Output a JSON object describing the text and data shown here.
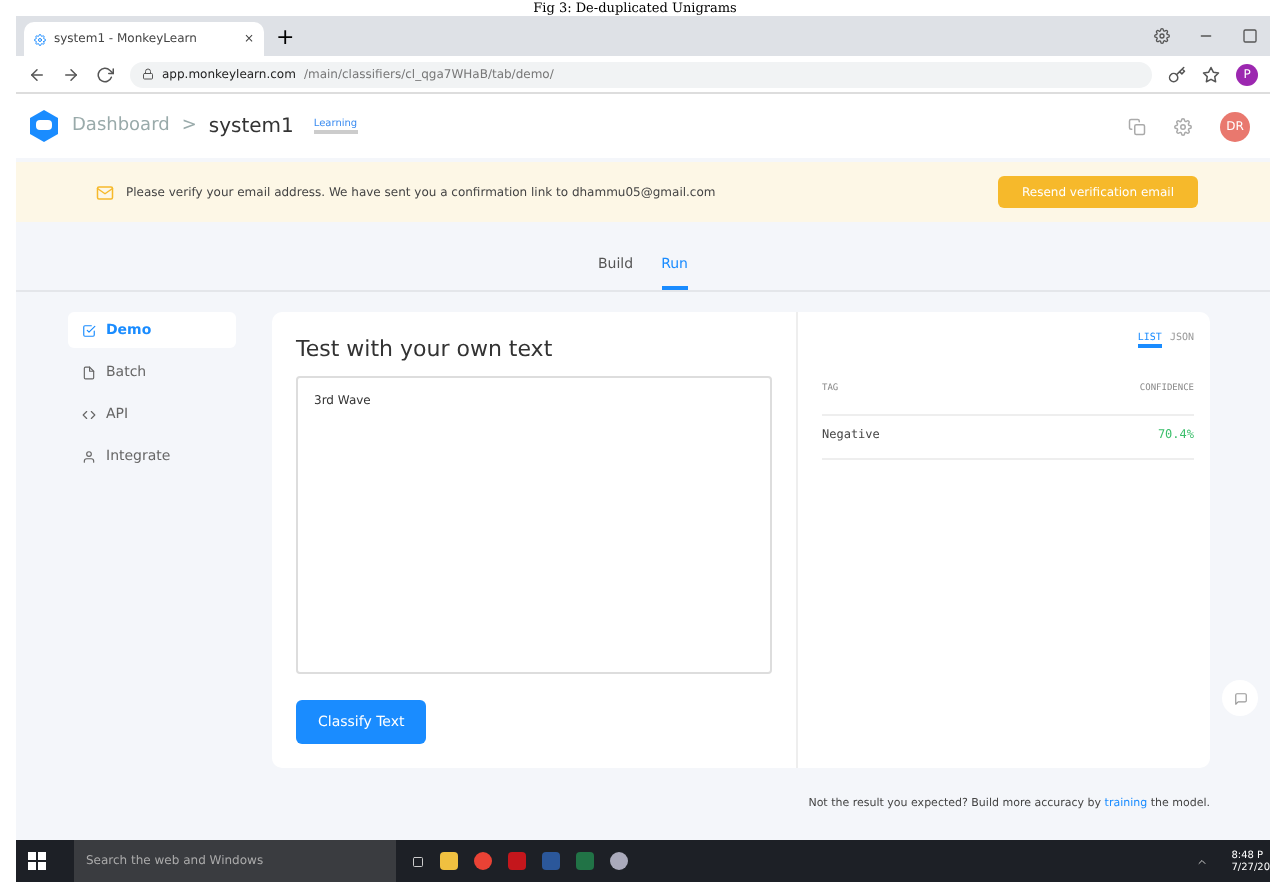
{
  "caption": "Fig 3:  De-duplicated Unigrams",
  "browser": {
    "tab_title": "system1 - MonkeyLearn",
    "tab_close": "×",
    "new_tab": "+",
    "url_host": "app.monkeylearn.com",
    "url_path": "/main/classifiers/cl_qga7WHaB/tab/demo/",
    "profile": "P"
  },
  "header": {
    "breadcrumb": "Dashboard",
    "separator": ">",
    "model": "system1",
    "badge": "Learning",
    "avatar": "DR"
  },
  "banner": {
    "message": "Please verify your email address. We have sent you a confirmation link to dhammu05@gmail.com",
    "button": "Resend verification email"
  },
  "tabs": [
    {
      "label": "Build",
      "selected": false
    },
    {
      "label": "Run",
      "selected": true
    }
  ],
  "sidebar": [
    {
      "label": "Demo",
      "kind": "demo",
      "selected": true
    },
    {
      "label": "Batch",
      "kind": "batch",
      "selected": false
    },
    {
      "label": "API",
      "kind": "api",
      "selected": false
    },
    {
      "label": "Integrate",
      "kind": "integrate",
      "selected": false
    }
  ],
  "test": {
    "title": "Test with your own text",
    "value": "3rd Wave",
    "button": "Classify Text"
  },
  "results": {
    "views": [
      {
        "label": "LIST",
        "selected": true
      },
      {
        "label": "JSON",
        "selected": false
      }
    ],
    "columns": [
      "TAG",
      "CONFIDENCE"
    ],
    "rows": [
      {
        "tag": "Negative",
        "confidence": "70.4%"
      }
    ]
  },
  "footer": {
    "before": "Not the result you expected? Build more accuracy by",
    "link": "training",
    "after": "the model."
  },
  "taskbar": {
    "search": "Search the web and Windows",
    "time": "8:48 P",
    "date": "7/27/20"
  }
}
